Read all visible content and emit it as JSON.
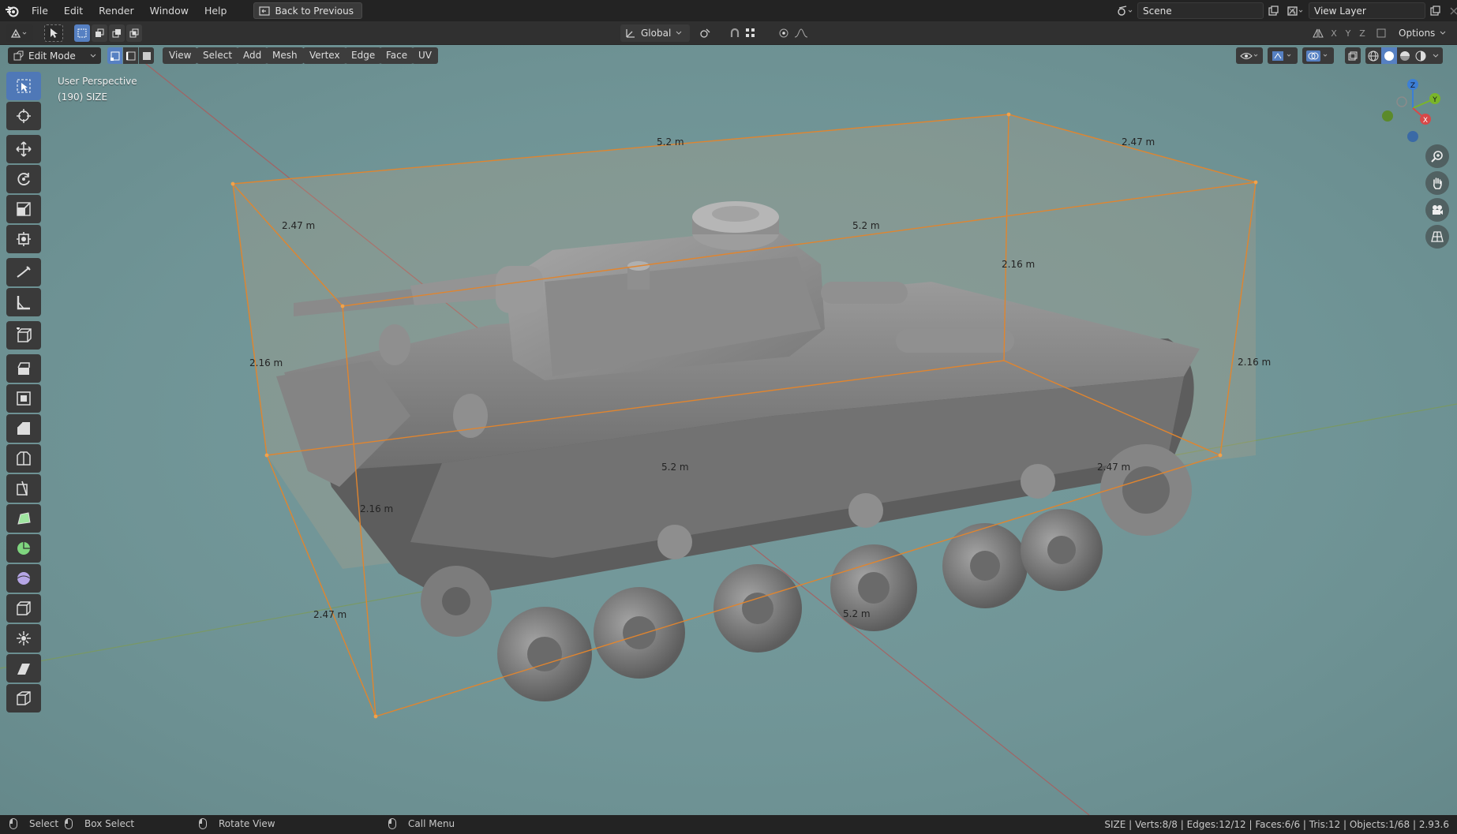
{
  "menu": {
    "items": [
      "File",
      "Edit",
      "Render",
      "Window",
      "Help"
    ],
    "back_button": "Back to Previous"
  },
  "scene": {
    "label": "Scene",
    "view_layer": "View Layer"
  },
  "tool_header": {
    "transform_orientation": "Global",
    "axes": [
      "X",
      "Y",
      "Z"
    ],
    "options_label": "Options"
  },
  "viewport_header": {
    "mode": "Edit Mode",
    "menus": [
      "View",
      "Select",
      "Add",
      "Mesh",
      "Vertex",
      "Edge",
      "Face",
      "UV"
    ]
  },
  "viewport": {
    "perspective_label": "User Perspective",
    "object_label": "(190) SIZE",
    "background_color": "#73989a",
    "box_edge_color": "#d87a2a",
    "dimensions": {
      "top_back": "5.2 m",
      "top_right_back": "2.47 m",
      "top_left": "2.47 m",
      "top_front": "5.2 m",
      "right_back_height": "2.16 m",
      "left_back_height": "2.16 m",
      "right_front_height": "2.16 m",
      "bottom_back": "5.2 m",
      "bottom_right": "2.47 m",
      "left_front_height": "2.16 m",
      "bottom_left": "2.47 m",
      "bottom_front": "5.2 m"
    },
    "gizmo_axes": {
      "z": "Z",
      "y": "Y",
      "x": "X"
    }
  },
  "toolbar": {
    "tools": [
      "select-box",
      "cursor",
      "move",
      "rotate",
      "scale",
      "transform",
      "annotate",
      "measure",
      "add-cube",
      "extrude",
      "inset",
      "bevel",
      "loop-cut",
      "knife",
      "poly-build",
      "spin",
      "smooth",
      "edge-slide",
      "shrink-fatten",
      "shear",
      "rip-region"
    ]
  },
  "status_bar": {
    "select": "Select",
    "box_select": "Box Select",
    "rotate_view": "Rotate View",
    "call_menu": "Call Menu",
    "stats": "SIZE | Verts:8/8 | Edges:12/12 | Faces:6/6 | Tris:12 | Objects:1/68 | 2.93.6"
  }
}
